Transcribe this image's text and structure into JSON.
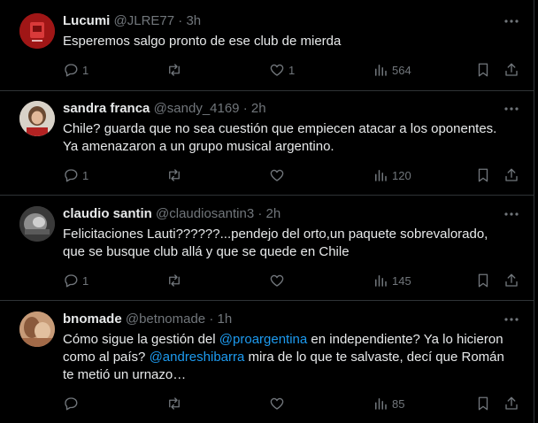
{
  "icons": {
    "reply": "reply-icon",
    "retweet": "retweet-icon",
    "like": "heart-icon",
    "views": "views-bar-chart-icon",
    "bookmark": "bookmark-icon",
    "share": "share-icon",
    "more": "more-dots-icon"
  },
  "colors": {
    "background": "#000000",
    "text": "#e7e9ea",
    "muted": "#71767b",
    "link": "#1d9bf0",
    "divider": "#2f3336"
  },
  "tweets": [
    {
      "name": "Lucumi",
      "handle": "@JLRE77",
      "sep": "·",
      "time": "3h",
      "lines": [
        "Esperemos salgo pronto de ese club de mierda"
      ],
      "replies": "1",
      "retweets": "",
      "likes": "1",
      "views": "564"
    },
    {
      "name": "sandra franca",
      "handle": "@sandy_4169",
      "sep": "·",
      "time": "2h",
      "lines": [
        "Chile? guarda que no sea cuestión que empiecen atacar a los oponentes.",
        "Ya amenazaron a un grupo musical argentino."
      ],
      "replies": "1",
      "retweets": "",
      "likes": "",
      "views": "120"
    },
    {
      "name": "claudio santin",
      "handle": "@claudiosantin3",
      "sep": "·",
      "time": "2h",
      "lines": [
        "Felicitaciones Lauti??????...pendejo del orto,un paquete sobrevalorado,",
        "que se busque club allá y que se quede en Chile"
      ],
      "replies": "1",
      "retweets": "",
      "likes": "",
      "views": "145"
    },
    {
      "name": "bnomade",
      "handle": "@betnomade",
      "sep": "·",
      "time": "1h",
      "line1_a": "Cómo sigue la gestión del ",
      "line1_mention": "@proargentina",
      "line1_b": " en independiente? Ya lo hicieron",
      "line2_a": "como al país? ",
      "line2_mention": "@andreshibarra",
      "line2_b": " mira de lo que te salvaste, decí que Román",
      "line3": "te metió un urnazo…",
      "replies": "",
      "retweets": "",
      "likes": "",
      "views": "85"
    }
  ]
}
